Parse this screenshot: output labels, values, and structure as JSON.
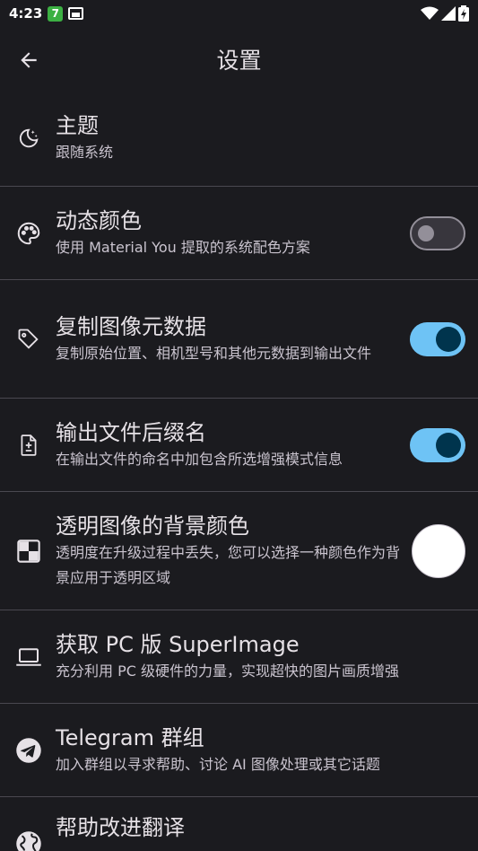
{
  "status_bar": {
    "time": "4:23",
    "badge": "7"
  },
  "app_bar": {
    "title": "设置"
  },
  "settings": [
    {
      "title": "主题",
      "subtitle": "跟随系统",
      "icon": "moon-stars-icon"
    },
    {
      "title": "动态颜色",
      "subtitle": "使用 Material You 提取的系统配色方案",
      "icon": "palette-icon",
      "toggle": false
    },
    {
      "title": "复制图像元数据",
      "subtitle": "复制原始位置、相机型号和其他元数据到输出文件",
      "icon": "tag-icon",
      "toggle": true
    },
    {
      "title": "输出文件后缀名",
      "subtitle": "在输出文件的命名中加包含所选增强模式信息",
      "icon": "file-diff-icon",
      "toggle": true
    },
    {
      "title": "透明图像的背景颜色",
      "subtitle": "透明度在升级过程中丢失，您可以选择一种颜色作为背景应用于透明区域",
      "icon": "transparency-icon",
      "swatch_color": "#ffffff"
    },
    {
      "title": "获取 PC 版 SuperImage",
      "subtitle": "充分利用 PC 级硬件的力量，实现超快的图片画质增强",
      "icon": "laptop-icon"
    },
    {
      "title": "Telegram 群组",
      "subtitle": "加入群组以寻求帮助、讨论 AI 图像处理或其它话题",
      "icon": "telegram-icon"
    },
    {
      "title": "帮助改进翻译",
      "icon": "globe-icon"
    }
  ],
  "colors": {
    "background": "#1b1b1f",
    "toggle_on": "#6ec3f5",
    "toggle_knob_on": "#00344d",
    "divider": "#4a4850"
  }
}
